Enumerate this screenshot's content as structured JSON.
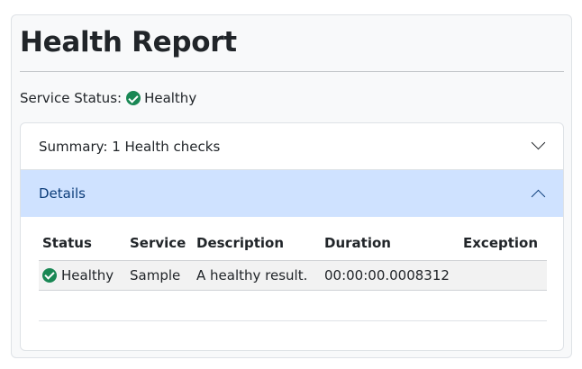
{
  "page": {
    "title": "Health Report"
  },
  "service_status": {
    "label": "Service Status:",
    "value": "Healthy",
    "icon": "check-circle-icon",
    "color": "#198754"
  },
  "accordion": {
    "summary": {
      "label": "Summary: 1 Health checks",
      "icon": "chevron-down-icon",
      "expanded": false
    },
    "details": {
      "label": "Details",
      "icon": "chevron-up-icon",
      "expanded": true,
      "background": "#cfe2ff"
    }
  },
  "table": {
    "headers": [
      "Status",
      "Service",
      "Description",
      "Duration",
      "Exception"
    ],
    "rows": [
      {
        "status": "Healthy",
        "status_icon": "check-circle-icon",
        "service": "Sample",
        "description": "A healthy result.",
        "duration": "00:00:00.0008312",
        "exception": ""
      }
    ]
  }
}
